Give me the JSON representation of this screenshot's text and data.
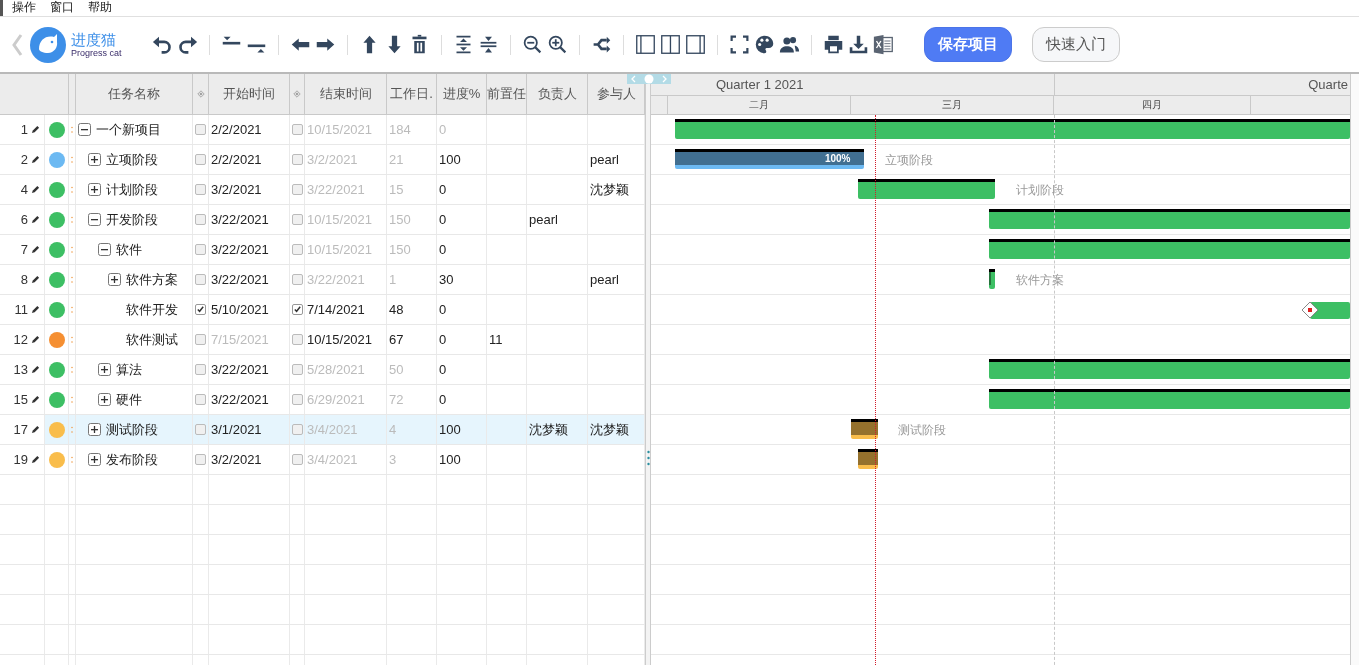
{
  "menu": [
    "操作",
    "窗口",
    "帮助"
  ],
  "logo": {
    "name": "进度猫",
    "subtitle": "Progress cat"
  },
  "buttons": [
    {
      "label": "保存项目",
      "kind": "primary"
    },
    {
      "label": "快速入门",
      "kind": "secondary"
    }
  ],
  "columns": [
    "任务名称",
    "开始时间",
    "结束时间",
    "工作日.",
    "进度%",
    "前置任",
    "负责人",
    "参与人"
  ],
  "timeline": {
    "quarters": [
      "Quarter 1 2021",
      "Quarte"
    ],
    "months": [
      "二月",
      "三月",
      "四月"
    ]
  },
  "split_slider": {
    "level": 0.5
  },
  "tasks": [
    {
      "id": "1",
      "color": "#3dbf64",
      "expanded": true,
      "selected": false,
      "name": "一个新项目",
      "start": "2/2/2021",
      "start_checked": false,
      "start_dim": false,
      "end": "10/15/2021",
      "end_checked": false,
      "end_dim": true,
      "days": "184",
      "days_dim": true,
      "progress": "0",
      "progress_dim": true,
      "children": [
        {
          "id": "2",
          "color": "#6cb9f2",
          "expanded": false,
          "selected": false,
          "name": "立项阶段",
          "start": "2/2/2021",
          "start_checked": false,
          "start_dim": false,
          "end": "3/2/2021",
          "end_checked": false,
          "end_dim": true,
          "days": "21",
          "days_dim": true,
          "progress": "100",
          "progress_dim": false,
          "participants": "pearl",
          "bar_text": "100%",
          "bar_label": "立项阶段"
        },
        {
          "id": "4",
          "color": "#3dbf64",
          "expanded": false,
          "selected": false,
          "name": "计划阶段",
          "start": "3/2/2021",
          "start_checked": false,
          "start_dim": false,
          "end": "3/22/2021",
          "end_checked": false,
          "end_dim": true,
          "days": "15",
          "days_dim": true,
          "progress": "0",
          "progress_dim": false,
          "participants": "沈梦颖",
          "bar_label": "计划阶段"
        },
        {
          "id": "6",
          "color": "#3dbf64",
          "expanded": true,
          "selected": false,
          "name": "开发阶段",
          "start": "3/22/2021",
          "start_checked": false,
          "start_dim": false,
          "end": "10/15/2021",
          "end_checked": false,
          "end_dim": true,
          "days": "150",
          "days_dim": true,
          "progress": "0",
          "progress_dim": false,
          "owner": "pearl",
          "children": [
            {
              "id": "7",
              "color": "#3dbf64",
              "expanded": true,
              "selected": false,
              "name": "软件",
              "start": "3/22/2021",
              "start_checked": false,
              "start_dim": false,
              "end": "10/15/2021",
              "end_checked": false,
              "end_dim": true,
              "days": "150",
              "days_dim": true,
              "progress": "0",
              "progress_dim": false,
              "children": [
                {
                  "id": "8",
                  "color": "#3dbf64",
                  "expanded": false,
                  "selected": false,
                  "name": "软件方案",
                  "start": "3/22/2021",
                  "start_checked": false,
                  "start_dim": false,
                  "end": "3/22/2021",
                  "end_checked": false,
                  "end_dim": true,
                  "days": "1",
                  "days_dim": true,
                  "progress": "30",
                  "progress_dim": false,
                  "participants": "pearl",
                  "bar_label": "软件方案"
                },
                {
                  "id": "11",
                  "color": "#3dbf64",
                  "selected": false,
                  "name": "软件开发",
                  "start": "5/10/2021",
                  "start_checked": true,
                  "start_dim": false,
                  "end": "7/14/2021",
                  "end_checked": true,
                  "end_dim": false,
                  "days": "48",
                  "days_dim": false,
                  "progress": "0",
                  "progress_dim": false
                },
                {
                  "id": "12",
                  "color": "#f58f32",
                  "selected": false,
                  "name": "软件测试",
                  "start": "7/15/2021",
                  "start_checked": false,
                  "start_dim": true,
                  "end": "10/15/2021",
                  "end_checked": false,
                  "end_dim": false,
                  "days": "67",
                  "days_dim": false,
                  "progress": "0",
                  "progress_dim": false,
                  "predecessor": "11"
                }
              ]
            },
            {
              "id": "13",
              "color": "#3dbf64",
              "expanded": false,
              "selected": false,
              "name": "算法",
              "start": "3/22/2021",
              "start_checked": false,
              "start_dim": false,
              "end": "5/28/2021",
              "end_checked": false,
              "end_dim": true,
              "days": "50",
              "days_dim": true,
              "progress": "0",
              "progress_dim": false
            },
            {
              "id": "15",
              "color": "#3dbf64",
              "expanded": false,
              "selected": false,
              "name": "硬件",
              "start": "3/22/2021",
              "start_checked": false,
              "start_dim": false,
              "end": "6/29/2021",
              "end_checked": false,
              "end_dim": true,
              "days": "72",
              "days_dim": true,
              "progress": "0",
              "progress_dim": false
            }
          ]
        },
        {
          "id": "17",
          "color": "#f9bd4b",
          "expanded": false,
          "selected": true,
          "name": "测试阶段",
          "start": "3/1/2021",
          "start_checked": false,
          "start_dim": false,
          "end": "3/4/2021",
          "end_checked": false,
          "end_dim": true,
          "days": "4",
          "days_dim": true,
          "progress": "100",
          "progress_dim": false,
          "owner": "沈梦颖",
          "participants": "沈梦颖",
          "bar_label": "测试阶段"
        },
        {
          "id": "19",
          "color": "#f9bd4b",
          "expanded": false,
          "selected": false,
          "name": "发布阶段",
          "start": "3/2/2021",
          "start_checked": false,
          "start_dim": false,
          "end": "3/4/2021",
          "end_checked": false,
          "end_dim": true,
          "days": "3",
          "days_dim": true,
          "progress": "100",
          "progress_dim": false
        }
      ]
    }
  ]
}
